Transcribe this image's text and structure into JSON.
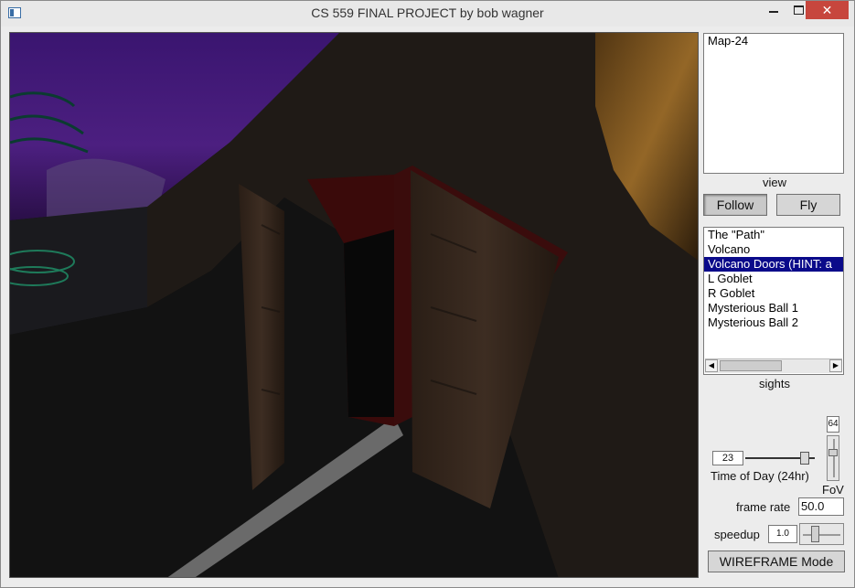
{
  "window": {
    "title": "CS 559 FINAL PROJECT by bob wagner",
    "controls": {
      "minimize": "",
      "maximize": "",
      "close": "✕"
    }
  },
  "map_list": {
    "items": [
      "Map-24"
    ]
  },
  "view": {
    "caption": "view",
    "buttons": [
      {
        "label": "Follow",
        "pressed": true
      },
      {
        "label": "Fly",
        "pressed": false
      }
    ]
  },
  "sights": {
    "caption": "sights",
    "items": [
      "The \"Path\"",
      "Volcano",
      "Volcano Doors (HINT: a",
      "L Goblet",
      "R Goblet",
      "Mysterious Ball 1",
      "Mysterious Ball 2"
    ],
    "selected_index": 2,
    "scroll_left": "◀",
    "scroll_right": "▶"
  },
  "fov": {
    "value": "64",
    "label": "FoV"
  },
  "time_of_day": {
    "value": "23",
    "label": "Time of Day (24hr)"
  },
  "frame_rate": {
    "label": "frame rate",
    "value": "50.0"
  },
  "speedup": {
    "label": "speedup",
    "value": "1.0"
  },
  "wireframe_button": {
    "label": "WIREFRAME Mode"
  },
  "colors": {
    "selection": "#0a0a8a",
    "close_button": "#c7463d"
  }
}
